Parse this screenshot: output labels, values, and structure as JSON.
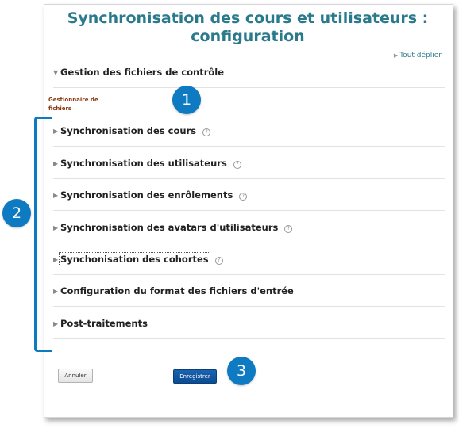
{
  "page": {
    "title_line1": "Synchronisation des cours et utilisateurs :",
    "title_line2": "configuration",
    "expand_all": "Tout déplier"
  },
  "sections": [
    {
      "label": "Gestion des fichiers de contrôle",
      "expanded": true
    },
    {
      "label": "Synchronisation des cours",
      "help": "?"
    },
    {
      "label": "Synchronisation des utilisateurs",
      "help": "?"
    },
    {
      "label": "Synchronisation des enrôlements",
      "help": "?"
    },
    {
      "label": "Synchronisation des avatars d'utilisateurs",
      "help": "?"
    },
    {
      "label": "Synchonisation des cohortes",
      "help": "?"
    },
    {
      "label": "Configuration du format des fichiers d'entrée"
    },
    {
      "label": "Post-traitements"
    }
  ],
  "file_manager": {
    "line1": "Gestionnaire de",
    "line2": "fichiers"
  },
  "buttons": {
    "cancel": "Annuler",
    "save": "Enregistrer"
  },
  "callouts": [
    "1",
    "2",
    "3"
  ],
  "colors": {
    "title": "#2a7a8c",
    "callout": "#0e7ac2",
    "save_button": "#1a63b0",
    "file_label": "#8a3b12"
  },
  "icons": {
    "collapsed": "triangle-right-icon",
    "expanded": "triangle-down-icon",
    "help": "help-icon"
  }
}
